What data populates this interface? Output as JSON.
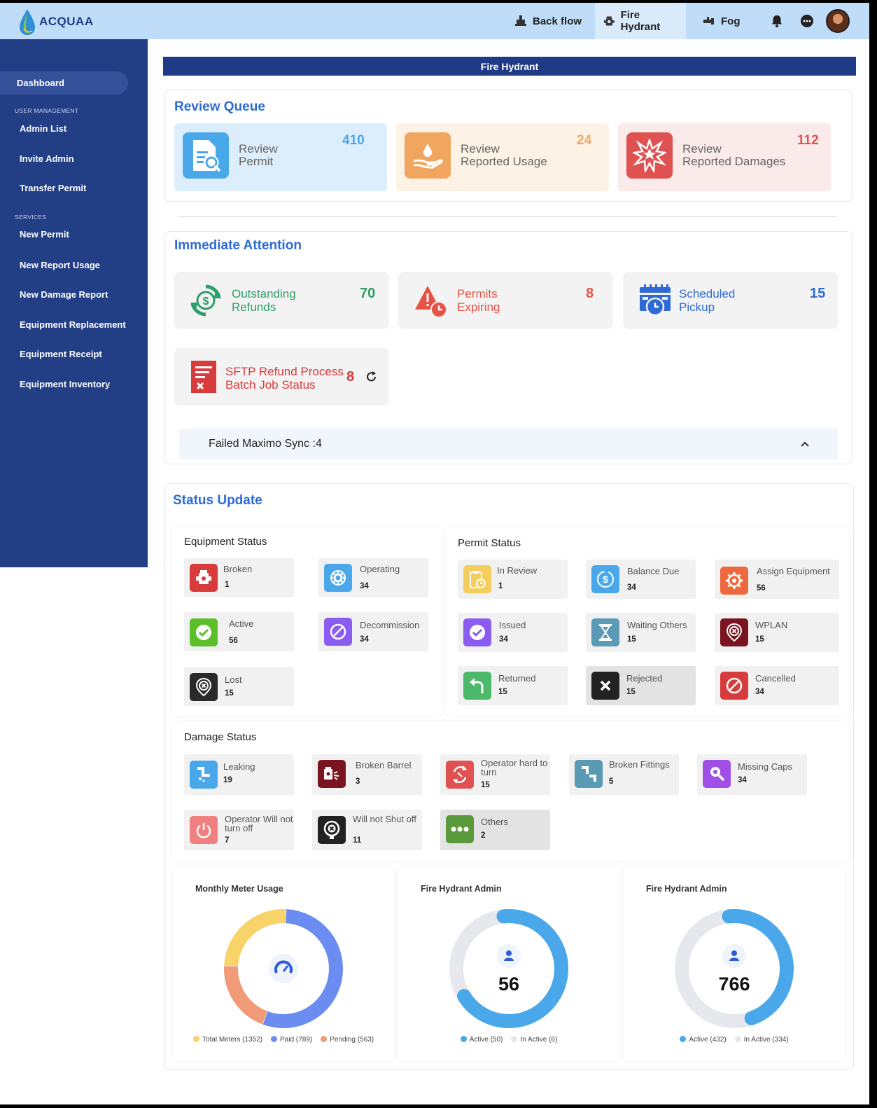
{
  "header": {
    "logo_text": "ACQUAA",
    "tabs": [
      {
        "label": "Back flow"
      },
      {
        "label": "Fire Hydrant"
      },
      {
        "label": "Fog"
      }
    ]
  },
  "sidebar": {
    "dashboard": "Dashboard",
    "section_user": "USER MANAGEMENT",
    "user_items": [
      "Admin List",
      "Invite Admin",
      "Transfer Permit"
    ],
    "section_services": "SERVICES",
    "service_items": [
      "New Permit",
      "New Report Usage",
      "New Damage Report",
      "Equipment Replacement",
      "Equipment Receipt",
      "Equipment Inventory"
    ]
  },
  "banner": "Fire Hydrant",
  "review_queue": {
    "title": "Review Queue",
    "cards": [
      {
        "line1": "Review",
        "line2": "Permit",
        "count": "410",
        "color": "#4aa8ea"
      },
      {
        "line1": "Review",
        "line2": "Reported Usage",
        "count": "24",
        "color": "#f1a660"
      },
      {
        "line1": "Review",
        "line2": "Reported Damages",
        "count": "112",
        "color": "#e05252"
      }
    ]
  },
  "immediate_attention": {
    "title": "Immediate Attention",
    "cards": [
      {
        "line1": "Outstanding",
        "line2": "Refunds",
        "count": "70",
        "color": "#2f9e6a"
      },
      {
        "line1": "Permits",
        "line2": "Expiring",
        "count": "8",
        "color": "#e55347"
      },
      {
        "line1": "Scheduled",
        "line2": "Pickup",
        "count": "15",
        "color": "#2d6ad6"
      },
      {
        "line1": "SFTP Refund Process",
        "line2": "Batch Job Status",
        "count": "8",
        "color": "#d73b3b"
      }
    ],
    "accordion": "Failed Maximo Sync :4"
  },
  "status_update": {
    "title": "Status Update",
    "equipment": {
      "title": "Equipment Status",
      "items": [
        {
          "label": "Broken",
          "count": "1"
        },
        {
          "label": "Operating",
          "count": "34"
        },
        {
          "label": "Active",
          "count": "56"
        },
        {
          "label": "Decommission",
          "count": "34"
        },
        {
          "label": "Lost",
          "count": "15"
        }
      ]
    },
    "permit": {
      "title": "Permit Status",
      "items": [
        {
          "label": "In Review",
          "count": "1"
        },
        {
          "label": "Balance Due",
          "count": "34"
        },
        {
          "label": "Assign Equipment",
          "count": "56"
        },
        {
          "label": "Issued",
          "count": "34"
        },
        {
          "label": "Waiting Others",
          "count": "15"
        },
        {
          "label": "WPLAN",
          "count": "15"
        },
        {
          "label": "Returned",
          "count": "15"
        },
        {
          "label": "Rejected",
          "count": "15"
        },
        {
          "label": "Cancelled",
          "count": "34"
        }
      ]
    },
    "damage": {
      "title": "Damage Status",
      "items": [
        {
          "label": "Leaking",
          "count": "19"
        },
        {
          "label": "Broken Barrel",
          "count": "3"
        },
        {
          "label": "Operator hard to turn",
          "count": "15"
        },
        {
          "label": "Broken Fittings",
          "count": "5"
        },
        {
          "label": "Missing Caps",
          "count": "34"
        },
        {
          "label": "Operator Will not turn off",
          "count": "7"
        },
        {
          "label": "Will not Shut off",
          "count": "11"
        },
        {
          "label": "Others",
          "count": "2"
        }
      ]
    }
  },
  "charts": [
    {
      "title": "Monthly Meter Usage",
      "legend": [
        "Total Meters (1352)",
        "Paid (789)",
        "Pending (563)"
      ],
      "colors": [
        "#f8d36a",
        "#6b8cf0",
        "#f19a78"
      ]
    },
    {
      "title": "Fire Hydrant Admin",
      "center": "56",
      "legend": [
        "Active (50)",
        "In Active (6)"
      ],
      "colors": [
        "#4aa8ea",
        "#e6e8ee"
      ]
    },
    {
      "title": "Fire Hydrant Admin",
      "center": "766",
      "legend": [
        "Active (432)",
        "In Active (334)"
      ],
      "colors": [
        "#4aa8ea",
        "#e6e8ee"
      ]
    }
  ],
  "chart_data": [
    {
      "type": "pie",
      "title": "Monthly Meter Usage",
      "categories": [
        "Total Meters",
        "Paid",
        "Pending"
      ],
      "values": [
        1352,
        789,
        563
      ],
      "legend": "bottom"
    },
    {
      "type": "pie",
      "title": "Fire Hydrant Admin",
      "categories": [
        "Active",
        "In Active"
      ],
      "values": [
        50,
        6
      ],
      "legend": "bottom"
    },
    {
      "type": "pie",
      "title": "Fire Hydrant Admin",
      "categories": [
        "Active",
        "In Active"
      ],
      "values": [
        432,
        334
      ],
      "legend": "bottom"
    }
  ]
}
